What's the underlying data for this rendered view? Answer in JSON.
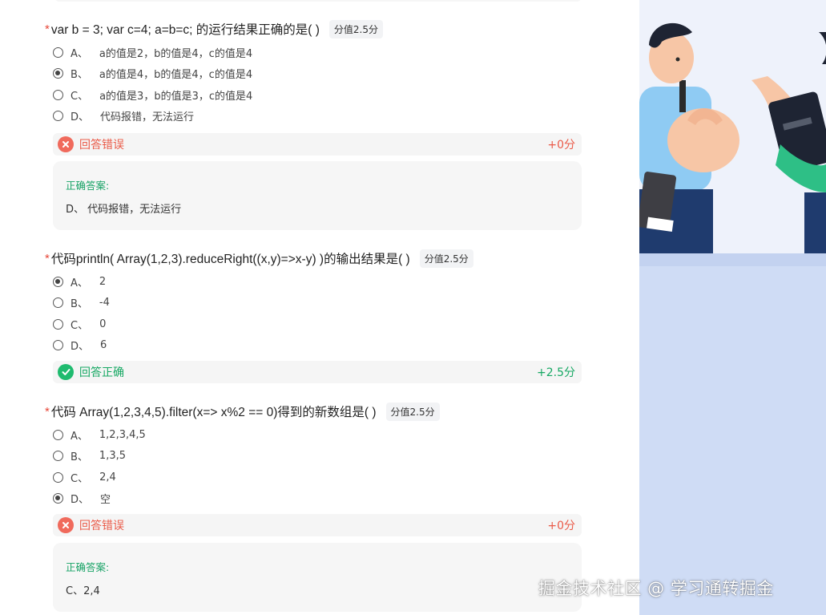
{
  "questions": [
    {
      "title": "var b = 3; var c=4; a=b=c; 的运行结果正确的是( )",
      "score_tag": "分值2.5分",
      "options": [
        {
          "letter": "A、",
          "text": "a的值是2，b的值是4，c的值是4",
          "selected": false
        },
        {
          "letter": "B、",
          "text": "a的值是4，b的值是4，c的值是4",
          "selected": true
        },
        {
          "letter": "C、",
          "text": "a的值是3，b的值是3，c的值是4",
          "selected": false
        },
        {
          "letter": "D、",
          "text": "代码报错，无法运行",
          "selected": false
        }
      ],
      "result": {
        "status": "wrong",
        "text": "回答错误",
        "score": "+0分"
      },
      "answer": {
        "label": "正确答案:",
        "value": "D、 代码报错，无法运行"
      }
    },
    {
      "title": "代码println( Array(1,2,3).reduceRight((x,y)=>x-y) )的输出结果是( )",
      "score_tag": "分值2.5分",
      "options": [
        {
          "letter": "A、",
          "text": "2",
          "selected": true
        },
        {
          "letter": "B、",
          "text": "-4",
          "selected": false
        },
        {
          "letter": "C、",
          "text": "0",
          "selected": false
        },
        {
          "letter": "D、",
          "text": "6",
          "selected": false
        }
      ],
      "result": {
        "status": "right",
        "text": "回答正确",
        "score": "+2.5分"
      }
    },
    {
      "title": "代码 Array(1,2,3,4,5).filter(x=> x%2 == 0)得到的新数组是( )",
      "score_tag": "分值2.5分",
      "options": [
        {
          "letter": "A、",
          "text": "1,2,3,4,5",
          "selected": false
        },
        {
          "letter": "B、",
          "text": "1,3,5",
          "selected": false
        },
        {
          "letter": "C、",
          "text": "2,4",
          "selected": false
        },
        {
          "letter": "D、",
          "text": "空",
          "selected": true
        }
      ],
      "result": {
        "status": "wrong",
        "text": "回答错误",
        "score": "+0分"
      },
      "answer": {
        "label": "正确答案:",
        "value": "C、2,4"
      }
    }
  ],
  "watermark": "掘金技术社区 @ 学习通转掘金",
  "colors": {
    "accent_wrong": "#ea5a48",
    "accent_right": "#16a863",
    "illustration_bg": "#cfdcf5"
  },
  "icons": {
    "wrong": "close-circle-icon",
    "right": "check-circle-icon"
  }
}
